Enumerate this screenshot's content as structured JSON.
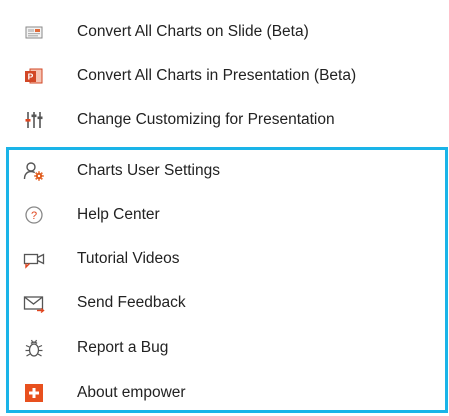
{
  "menu": {
    "items": [
      {
        "label": "Convert All Charts on Slide (Beta)",
        "icon": "slide-chart-icon"
      },
      {
        "label": "Convert All Charts in Presentation (Beta)",
        "icon": "powerpoint-icon"
      },
      {
        "label": "Change Customizing for Presentation",
        "icon": "sliders-icon"
      },
      {
        "label": "Charts User Settings",
        "icon": "user-settings-icon"
      },
      {
        "label": "Help Center",
        "icon": "help-icon"
      },
      {
        "label": "Tutorial Videos",
        "icon": "video-camera-icon"
      },
      {
        "label": "Send Feedback",
        "icon": "envelope-icon"
      },
      {
        "label": "Report a Bug",
        "icon": "bug-icon"
      },
      {
        "label": "About empower",
        "icon": "empower-logo-icon"
      }
    ]
  },
  "colors": {
    "highlight_border": "#1ab4e8",
    "powerpoint_orange": "#d24726",
    "empower_orange": "#e8501e",
    "settings_orange": "#e05a1a",
    "icon_gray": "#555555"
  }
}
